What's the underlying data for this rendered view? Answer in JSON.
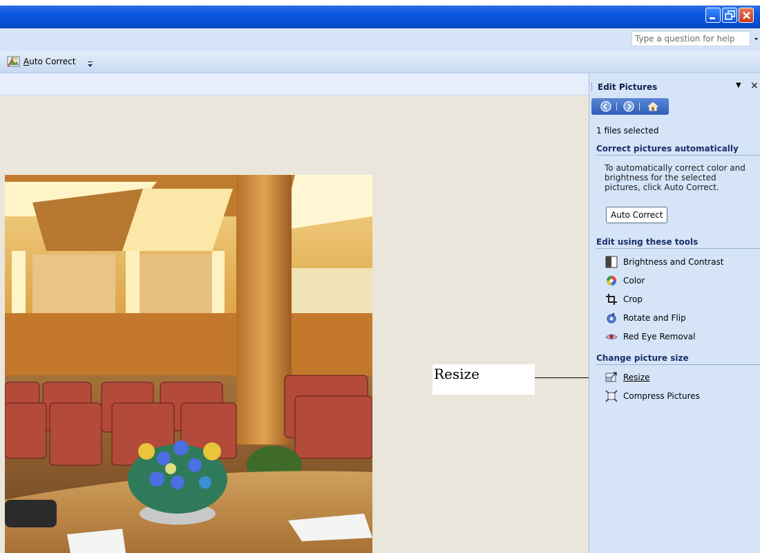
{
  "window": {
    "minimize_icon": "minimize-icon",
    "restore_icon": "restore-icon",
    "close_icon": "close-icon"
  },
  "help": {
    "placeholder": "Type a question for help"
  },
  "toolbar": {
    "auto_correct_label": "Auto Correct",
    "auto_correct_shortcut_char": "A",
    "auto_correct_rest": "uto Correct"
  },
  "callout": {
    "text": "Resize"
  },
  "task_pane": {
    "title": "Edit Pictures",
    "files_selected": "1 files selected",
    "section_auto": "Correct pictures automatically",
    "auto_description": "To automatically correct color and brightness for the selected pictures, click Auto Correct.",
    "auto_correct_button": "Auto Correct",
    "section_tools": "Edit using these tools",
    "tools": [
      {
        "label": "Brightness and Contrast",
        "icon": "brightness-contrast-icon"
      },
      {
        "label": "Color",
        "icon": "color-icon"
      },
      {
        "label": "Crop",
        "icon": "crop-icon"
      },
      {
        "label": "Rotate and Flip",
        "icon": "rotate-flip-icon"
      },
      {
        "label": "Red Eye Removal",
        "icon": "red-eye-icon"
      }
    ],
    "section_size": "Change picture size",
    "size_tools": [
      {
        "label": "Resize",
        "icon": "resize-icon"
      },
      {
        "label": "Compress Pictures",
        "icon": "compress-icon"
      }
    ]
  },
  "colors": {
    "titlebar": "#0650d6",
    "taskpane_bg": "#d6e4f8",
    "canvas_bg": "#eae6db",
    "section_heading": "#18306a"
  }
}
